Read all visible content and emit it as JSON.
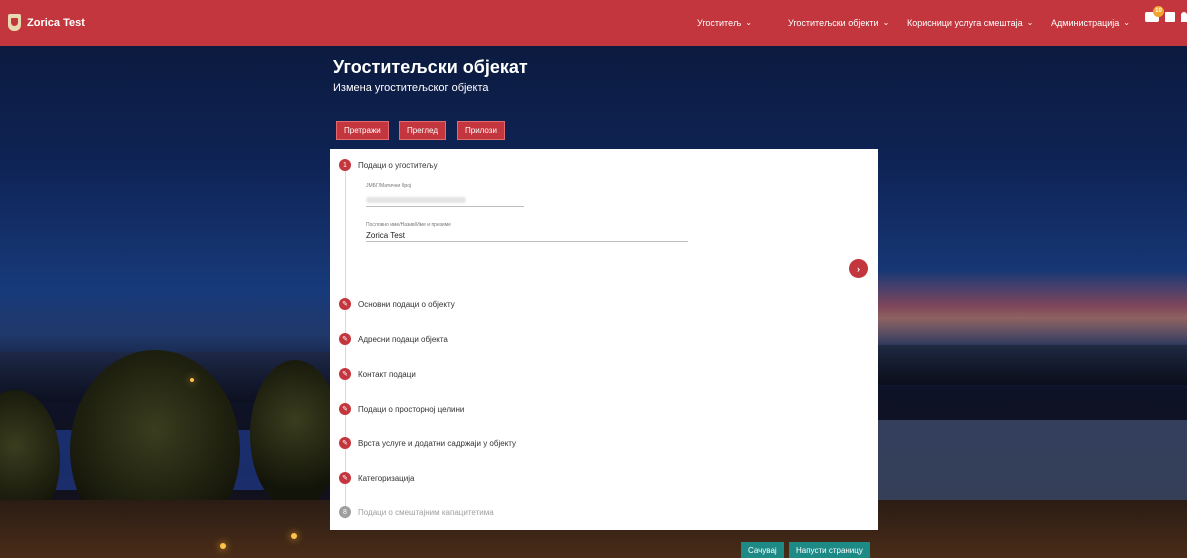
{
  "app": {
    "brand_name": "Zorica Test"
  },
  "nav": [
    {
      "label": "Угоститељ"
    },
    {
      "label": "Угоститељски објекти"
    },
    {
      "label": "Корисници услуга смештаја"
    },
    {
      "label": "Администрација"
    }
  ],
  "notifications": {
    "count": "10"
  },
  "page": {
    "title": "Угоститељски објекат",
    "subtitle": "Измена угоститељског објекта"
  },
  "tabs": [
    {
      "label": "Претражи"
    },
    {
      "label": "Преглед"
    },
    {
      "label": "Прилози"
    }
  ],
  "steps": [
    {
      "number": "1",
      "label": "Подаци о угоститељу"
    },
    {
      "label": "Основни подаци о објекту"
    },
    {
      "label": "Адресни подаци објекта"
    },
    {
      "label": "Контакт подаци"
    },
    {
      "label": "Подаци о просторној целини"
    },
    {
      "label": "Врста услуге и додатни садржаји у објекту"
    },
    {
      "label": "Категоризација"
    },
    {
      "number": "8",
      "label": "Подаци о смештајним капацитетима"
    }
  ],
  "form": {
    "jmbg_label": "ЈМБГ/Матични број",
    "name_label": "Пословно име/Назив/Име и презиме",
    "name_value": "Zorica Test"
  },
  "footer": {
    "save_label": "Сачувај",
    "leave_label": "Напусти страницу"
  },
  "colors": {
    "primary": "#c3363d",
    "secondary": "#1e8a86"
  }
}
